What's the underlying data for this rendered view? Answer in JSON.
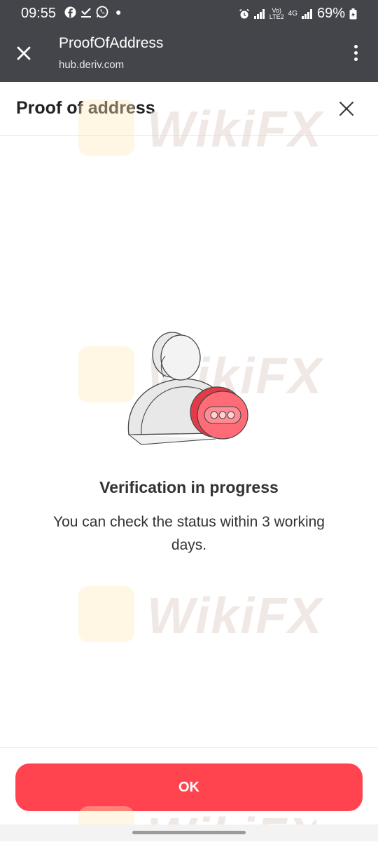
{
  "status_bar": {
    "time": "09:55",
    "left_icons": [
      "facebook-icon",
      "download-icon",
      "whatsapp-icon",
      "dot-icon"
    ],
    "network_label_top": "Vo)",
    "network_label_bottom": "LTE2",
    "network_type": "4G",
    "battery": "69%"
  },
  "tab": {
    "title": "ProofOfAddress",
    "url": "hub.deriv.com"
  },
  "page": {
    "title": "Proof of address"
  },
  "status": {
    "title": "Verification in progress",
    "description": "You can check the status within 3 working days."
  },
  "footer": {
    "ok_label": "OK"
  },
  "watermark": {
    "text": "WikiFX"
  },
  "colors": {
    "accent": "#ff444f",
    "chrome": "#43454b"
  }
}
